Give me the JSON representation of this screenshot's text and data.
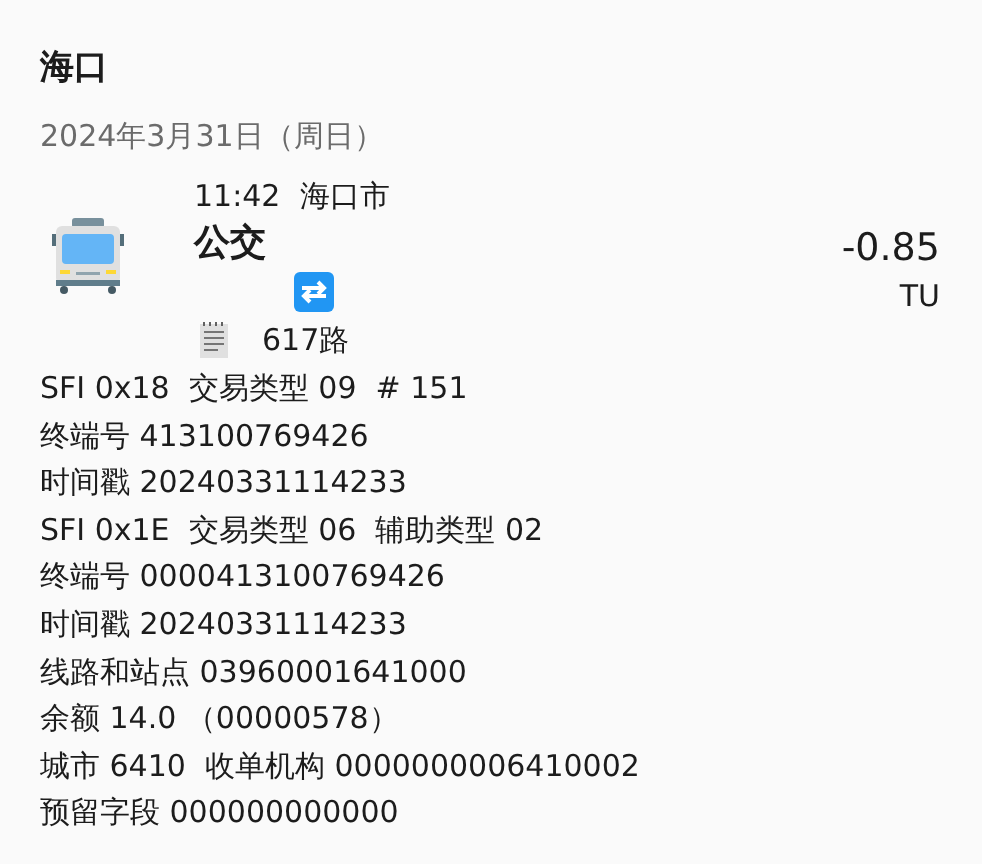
{
  "header": {
    "title": "海口",
    "date": "2024年3月31日（周日）"
  },
  "transaction": {
    "time": "11:42",
    "place": "海口市",
    "type": "公交",
    "amount": "-0.85",
    "currency": "TU",
    "route": "617路"
  },
  "details": [
    "SFI 0x18  交易类型 09  # 151",
    "终端号 413100769426",
    "时间戳 20240331114233",
    "SFI 0x1E  交易类型 06  辅助类型 02",
    "终端号 0000413100769426",
    "时间戳 20240331114233",
    "线路和站点 03960001641000",
    "余额 14.0 （00000578）",
    "城市 6410  收单机构 0000000006410002",
    "预留字段 000000000000"
  ]
}
